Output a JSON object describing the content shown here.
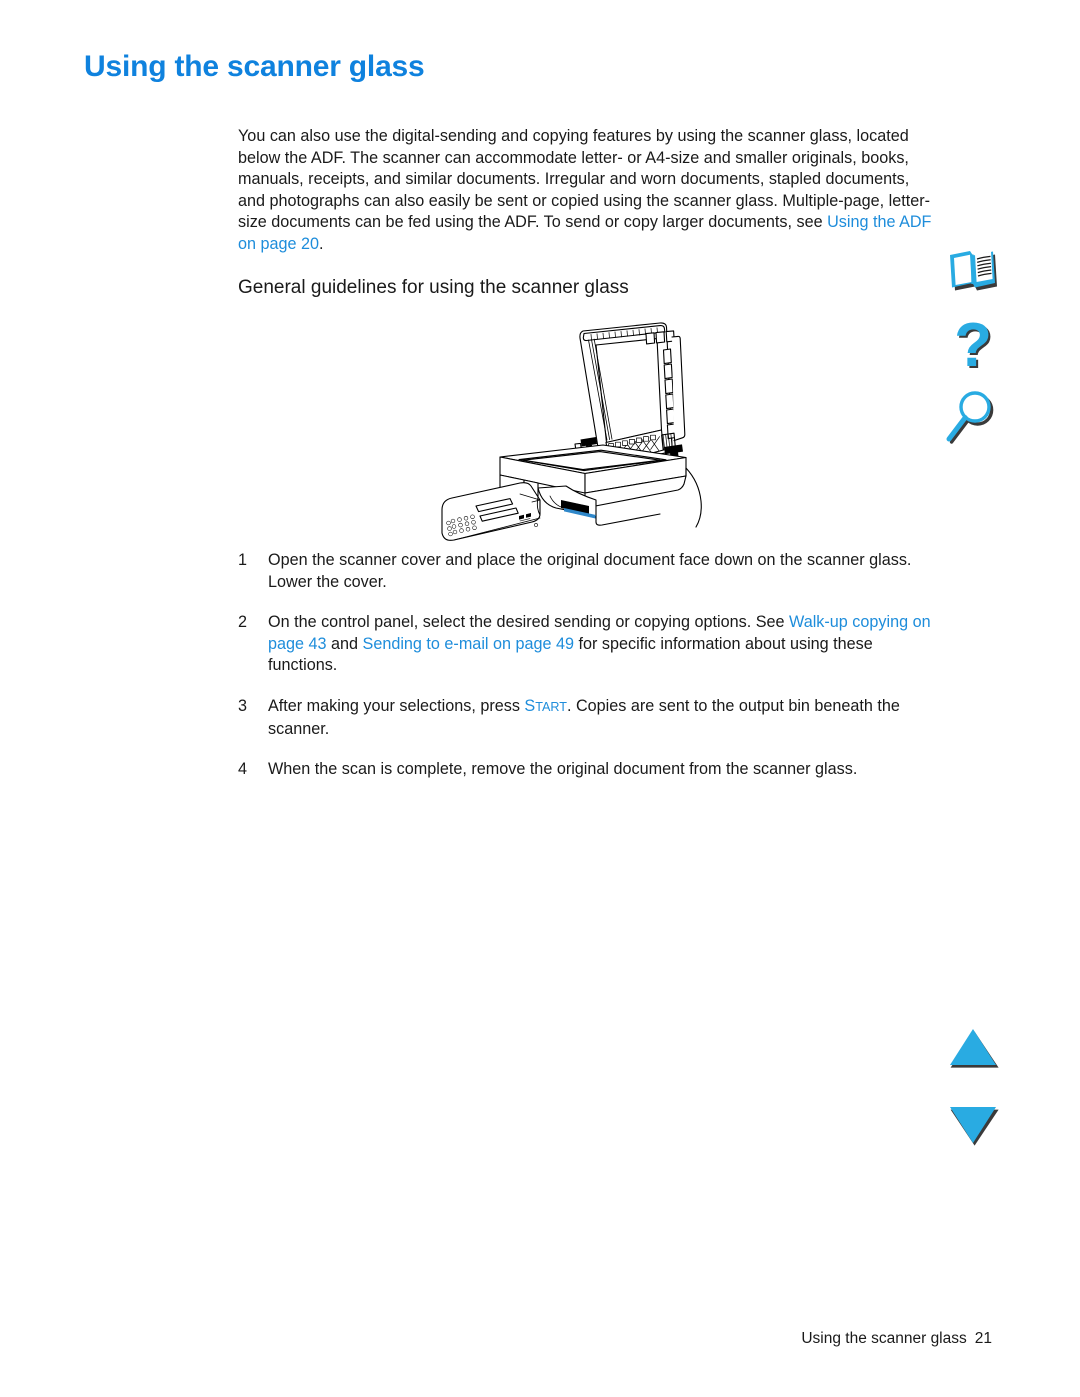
{
  "document": {
    "title": "Using the scanner glass",
    "accent_heading_color": "#0f82de",
    "link_color": "#1e8ddb",
    "icon_color": "#29abe2",
    "body_color": "#1a1a1a",
    "background": "#ffffff"
  },
  "intro": {
    "text_before_link": "You can also use the digital-sending and copying features by using the scanner glass, located below the ADF. The scanner can accommodate letter- or A4-size and smaller originals, books, manuals, receipts, and similar documents. Irregular and worn documents, stapled documents, and photographs can also easily be sent or copied using the scanner glass. Multiple-page, letter-size documents can be fed using the ADF. To send or copy larger documents, see ",
    "link_label": "Using the ADF",
    "link_page": " on page 20",
    "text_after_link": "."
  },
  "subheading": "General guidelines for using the scanner glass",
  "figure": {
    "caption": "",
    "alt_name": "scanner-with-open-lid-illustration"
  },
  "steps": [
    {
      "number": "1",
      "segments": [
        {
          "type": "text",
          "value": "Open the scanner cover and place the original document face down on the scanner glass. Lower the cover."
        }
      ]
    },
    {
      "number": "2",
      "segments": [
        {
          "type": "text",
          "value": "On the control panel, select the desired sending or copying options. See "
        },
        {
          "type": "link",
          "value": "Walk-up copying"
        },
        {
          "type": "link",
          "value": " on page 43"
        },
        {
          "type": "text",
          "value": " and "
        },
        {
          "type": "link",
          "value": "Sending to e-mail"
        },
        {
          "type": "link",
          "value": " on page 49"
        },
        {
          "type": "text",
          "value": " for specific information about using these functions."
        }
      ]
    },
    {
      "number": "3",
      "segments": [
        {
          "type": "text",
          "value": "After making your selections, press "
        },
        {
          "type": "smallcaps",
          "value": "START",
          "first": "S",
          "rest": "TART"
        },
        {
          "type": "text",
          "value": ". Copies are sent to the output bin beneath the scanner."
        }
      ]
    },
    {
      "number": "4",
      "segments": [
        {
          "type": "text",
          "value": "When the scan is complete, remove the original document from the scanner glass."
        }
      ]
    }
  ],
  "nav_icons": [
    {
      "name": "contents-book-icon",
      "label": "Contents"
    },
    {
      "name": "help-question-icon",
      "label": "Help"
    },
    {
      "name": "search-magnifier-icon",
      "label": "Search"
    },
    {
      "name": "previous-page-triangle-icon",
      "label": "Previous"
    },
    {
      "name": "next-page-triangle-icon",
      "label": "Next"
    }
  ],
  "footer": {
    "section": "Using the scanner glass",
    "page_number": "21"
  }
}
